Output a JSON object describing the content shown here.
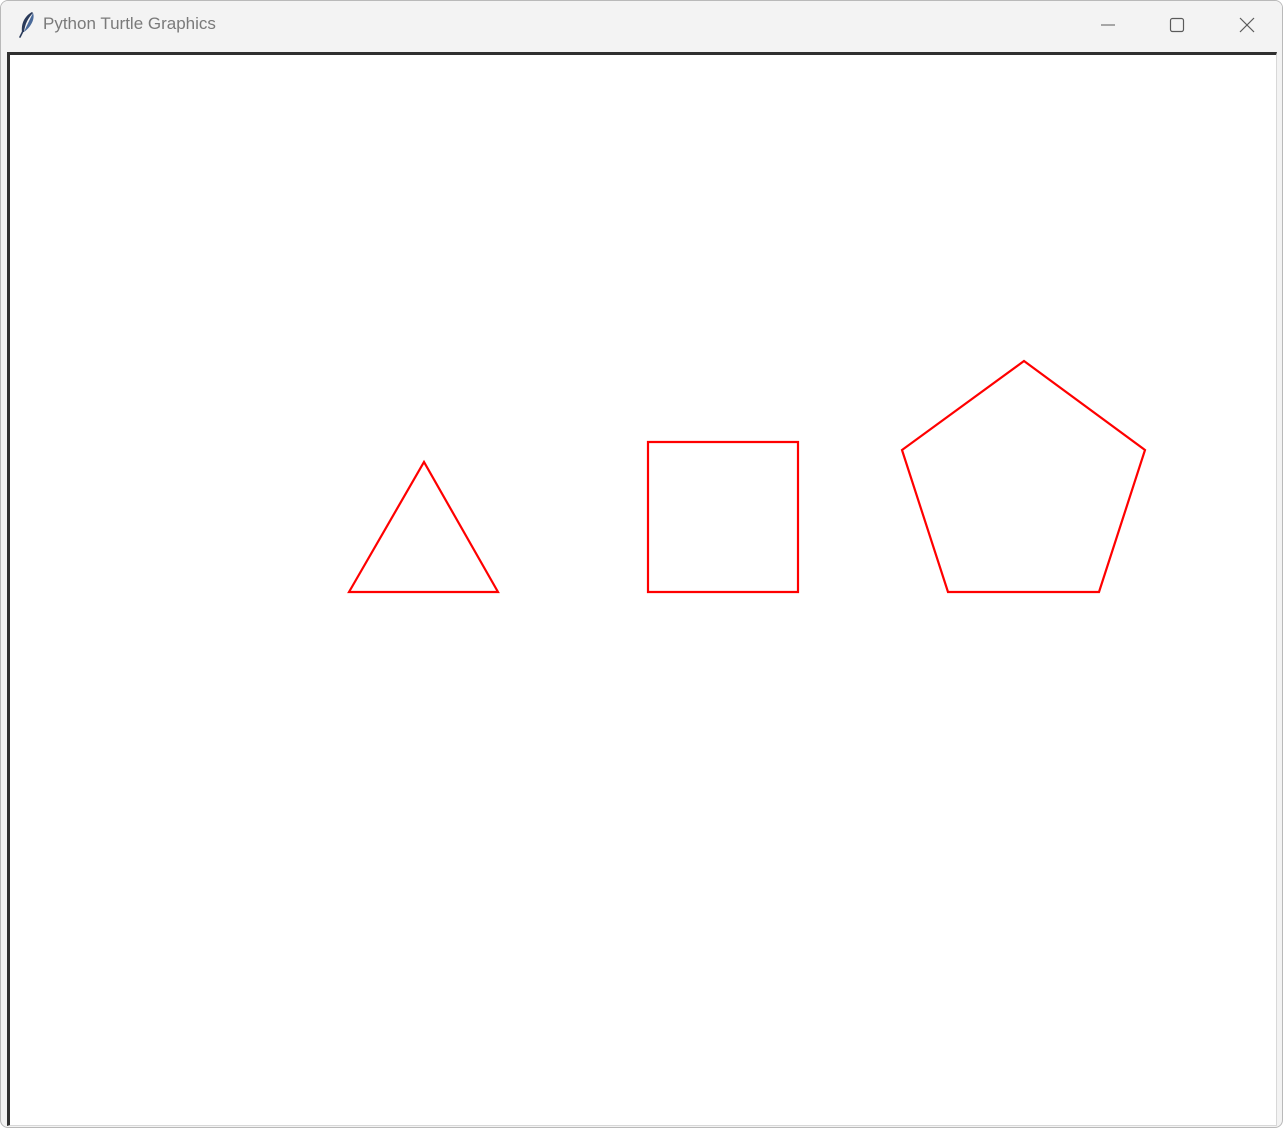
{
  "window": {
    "title": "Python Turtle Graphics",
    "icon": "feather-icon",
    "controls": {
      "minimize": "minimize-icon",
      "maximize": "maximize-icon",
      "close": "close-icon"
    }
  },
  "canvas": {
    "background": "#ffffff",
    "pen_color": "#ff0000",
    "shapes": [
      {
        "name": "triangle",
        "sides": 3
      },
      {
        "name": "square",
        "sides": 4
      },
      {
        "name": "pentagon",
        "sides": 5
      }
    ]
  }
}
